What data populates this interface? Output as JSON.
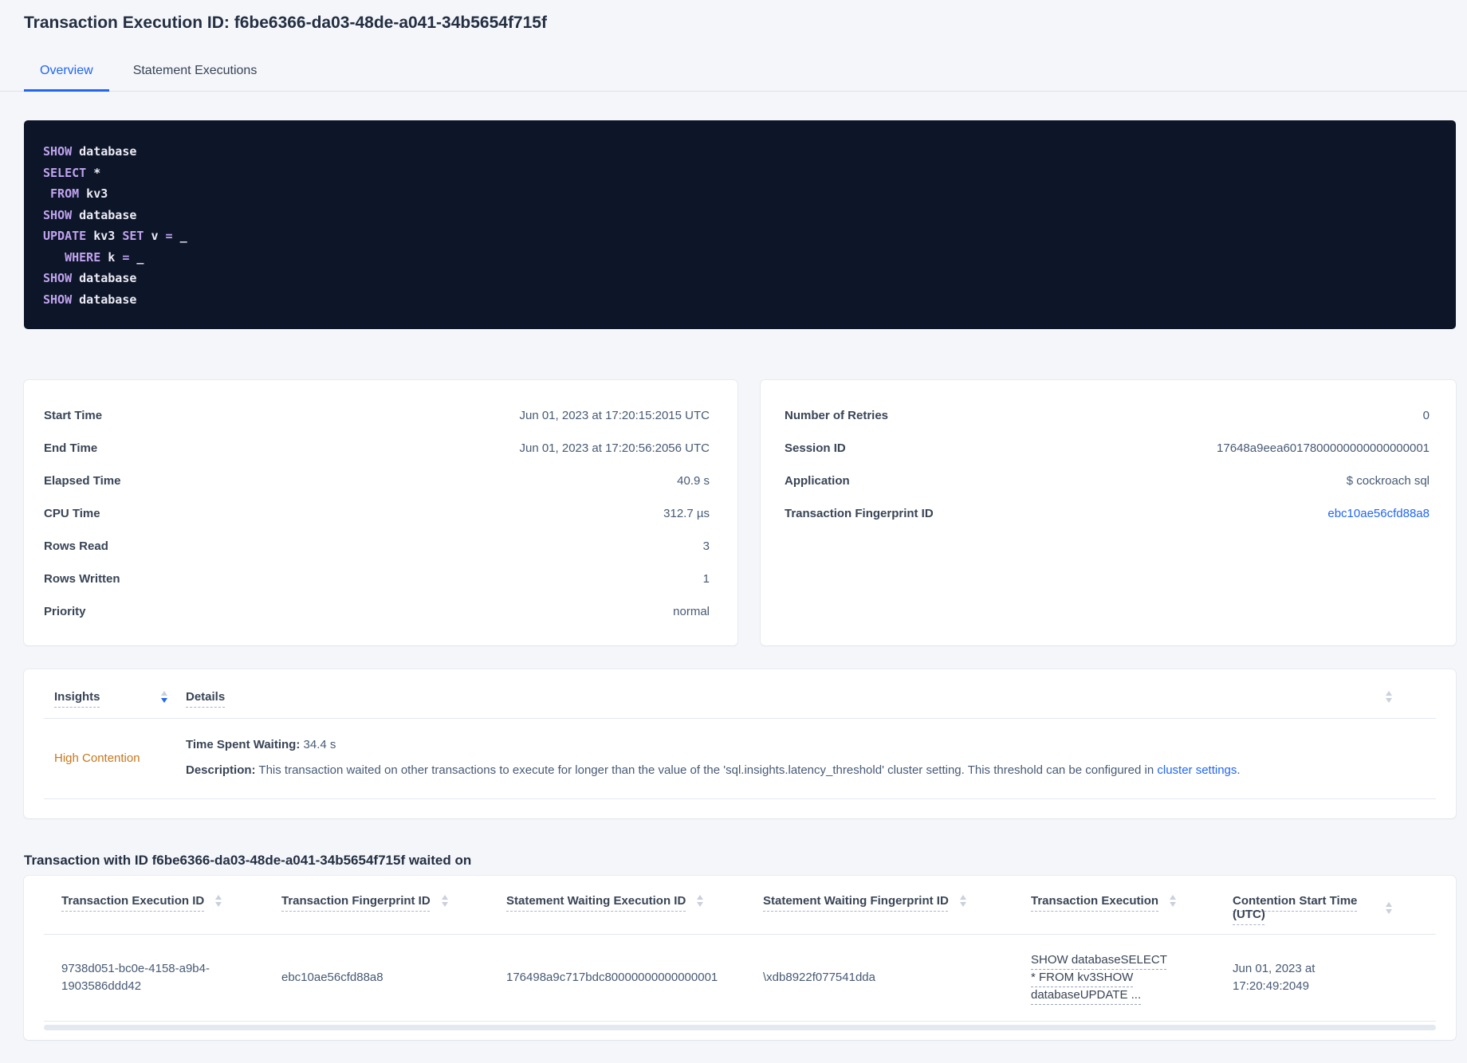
{
  "page": {
    "title": "Transaction Execution ID: f6be6366-da03-48de-a041-34b5654f715f",
    "tabs": [
      {
        "label": "Overview",
        "active": true
      },
      {
        "label": "Statement Executions",
        "active": false
      }
    ]
  },
  "sql": {
    "lines": [
      {
        "s0": "SHOW",
        "s1": " database"
      },
      {
        "s0": "SELECT",
        "s1": " *"
      },
      {
        "s0": " ",
        "s1": "FROM",
        "s2": " kv3"
      },
      {
        "s0": "SHOW",
        "s1": " database"
      },
      {
        "s0": "UPDATE",
        "s1": " kv3 ",
        "s2": "SET",
        "s3": " v ",
        "s4": "=",
        "s5": " _"
      },
      {
        "s0": "   ",
        "s1": "WHERE",
        "s2": " k ",
        "s3": "=",
        "s4": " _"
      },
      {
        "s0": "SHOW",
        "s1": " database"
      },
      {
        "s0": "SHOW",
        "s1": " database"
      }
    ]
  },
  "left_panel": {
    "rows": [
      {
        "label": "Start Time",
        "value": "Jun 01, 2023 at 17:20:15:2015 UTC"
      },
      {
        "label": "End Time",
        "value": "Jun 01, 2023 at 17:20:56:2056 UTC"
      },
      {
        "label": "Elapsed Time",
        "value": "40.9 s"
      },
      {
        "label": "CPU Time",
        "value": "312.7 µs"
      },
      {
        "label": "Rows Read",
        "value": "3"
      },
      {
        "label": "Rows Written",
        "value": "1"
      },
      {
        "label": "Priority",
        "value": "normal"
      }
    ]
  },
  "right_panel": {
    "rows": [
      {
        "label": "Number of Retries",
        "value": "0"
      },
      {
        "label": "Session ID",
        "value": "17648a9eea6017800000000000000001"
      },
      {
        "label": "Application",
        "value": "$ cockroach sql"
      },
      {
        "label": "Transaction Fingerprint ID",
        "value": "ebc10ae56cfd88a8"
      }
    ]
  },
  "insights": {
    "header": {
      "insights": "Insights",
      "details": "Details"
    },
    "row": {
      "insight": "High Contention",
      "waiting_label": "Time Spent Waiting:",
      "waiting_value": " 34.4 s",
      "description_label": "Description:",
      "description_text": " This transaction waited on other transactions to execute for longer than the value of the 'sql.insights.latency_threshold' cluster setting. This threshold can be configured in ",
      "description_link": "cluster settings",
      "description_suffix": "."
    }
  },
  "waited_on": {
    "title": "Transaction with ID f6be6366-da03-48de-a041-34b5654f715f waited on",
    "columns": [
      "Transaction Execution ID",
      "Transaction Fingerprint ID",
      "Statement Waiting Execution ID",
      "Statement Waiting Fingerprint ID",
      "Transaction Execution",
      "Contention Start Time (UTC)"
    ],
    "row": {
      "transaction_execution_id": "9738d051-bc0e-4158-a9b4-1903586ddd42",
      "transaction_fingerprint_id": "ebc10ae56cfd88a8",
      "statement_waiting_execution_id": "176498a9c717bdc80000000000000001",
      "statement_waiting_fingerprint_id": "\\xdb8922f077541dda",
      "transaction_execution": "SHOW databaseSELECT * FROM kv3SHOW databaseUPDATE ...",
      "contention_start_time": "Jun 01, 2023 at 17:20:49:2049"
    }
  },
  "colors": {
    "accent_blue": "#2166f2",
    "insight_orange": "#c7761b",
    "code_background": "#0d1628",
    "code_keyword": "#c0a3ef",
    "code_plain": "#eceaf6",
    "page_background": "#f4f6fa"
  }
}
